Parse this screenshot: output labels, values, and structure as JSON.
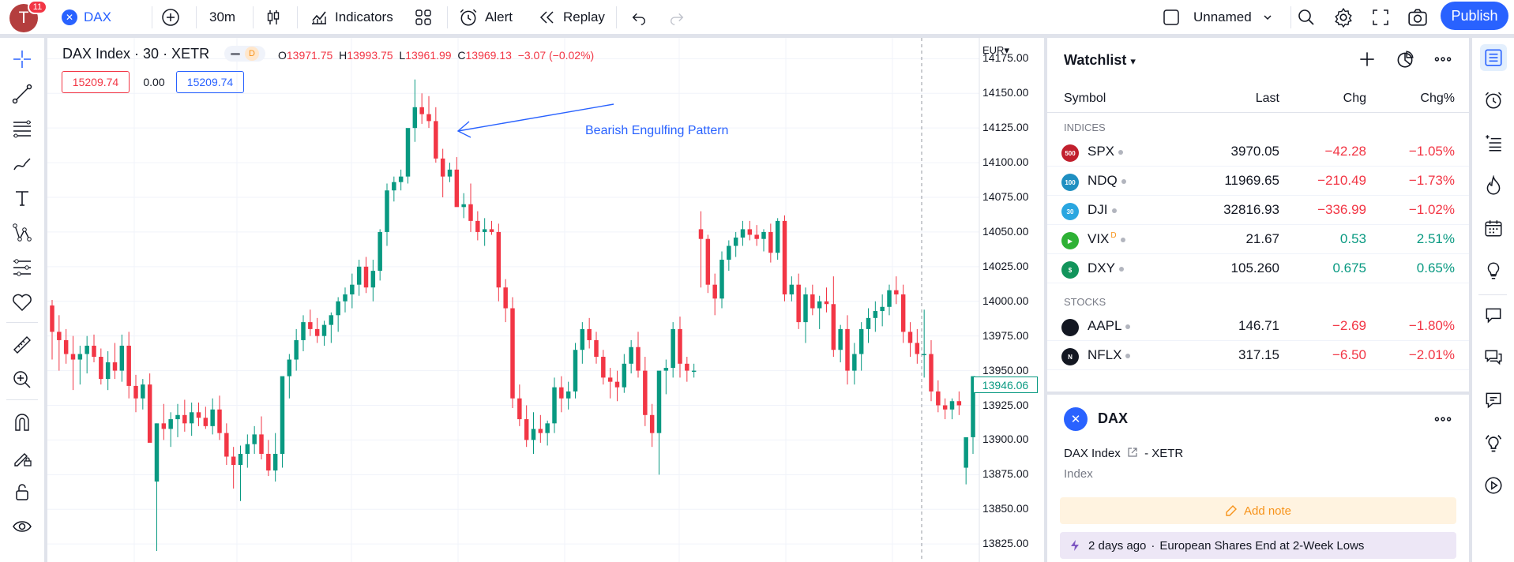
{
  "header": {
    "avatar_letter": "T",
    "notification_count": "11",
    "symbol": "DAX",
    "symbol_logo_glyph": "✕",
    "interval": "30m",
    "indicators_label": "Indicators",
    "alert_label": "Alert",
    "replay_label": "Replay",
    "layout_name": "Unnamed",
    "publish_label": "Publish",
    "icons": [
      "plus-circle-icon",
      "candles-icon",
      "indicators-icon",
      "templates-grid-icon",
      "alarm-clock-icon",
      "replay-icon",
      "undo-icon",
      "redo-icon",
      "layout-square-icon",
      "chevron-down-icon",
      "search-icon",
      "gear-icon",
      "fullscreen-icon",
      "camera-icon"
    ]
  },
  "left_toolbar": {
    "icons": [
      "crosshair-icon",
      "trend-line-icon",
      "fib-icon",
      "brush-icon",
      "text-icon",
      "pattern-icon",
      "forecast-icon",
      "favorites-heart-icon",
      "ruler-icon",
      "zoom-in-icon",
      "magnet-icon",
      "lock-drawing-icon",
      "lock-icon",
      "eye-icon"
    ]
  },
  "legend": {
    "title": "DAX Index · 30 · XETR",
    "delay_badge": "D",
    "open_label": "O",
    "open": "13971.75",
    "high_label": "H",
    "high": "13993.75",
    "low_label": "L",
    "low": "13961.99",
    "close_label": "C",
    "close": "13969.13",
    "change": "−3.07 (−0.02%)",
    "bid": "15209.74",
    "spread": "0.00",
    "ask": "15209.74"
  },
  "chart_data": {
    "type": "candlestick",
    "currency": "EUR",
    "annotation": "Bearish Engulfing Pattern",
    "last_price": "13946.06",
    "y_ticks": [
      "14175.00",
      "14150.00",
      "14125.00",
      "14100.00",
      "14075.00",
      "14050.00",
      "14025.00",
      "14000.00",
      "13975.00",
      "13950.00",
      "13925.00",
      "13900.00",
      "13875.00",
      "13850.00",
      "13825.00"
    ],
    "ylim": [
      13812,
      14190
    ],
    "colors": {
      "up": "#089981",
      "down": "#f23645",
      "grid": "#f0f3fa",
      "annotation": "#2962ff"
    },
    "candles": [
      [
        13997,
        14001,
        13958,
        13978
      ],
      [
        13978,
        13990,
        13950,
        13972
      ],
      [
        13972,
        13980,
        13955,
        13962
      ],
      [
        13962,
        13975,
        13936,
        13958
      ],
      [
        13958,
        13968,
        13940,
        13962
      ],
      [
        13962,
        13975,
        13948,
        13968
      ],
      [
        13968,
        13976,
        13956,
        13960
      ],
      [
        13960,
        13966,
        13940,
        13944
      ],
      [
        13944,
        13964,
        13936,
        13956
      ],
      [
        13956,
        13970,
        13944,
        13950
      ],
      [
        13950,
        13976,
        13942,
        13968
      ],
      [
        13968,
        13978,
        13930,
        13939
      ],
      [
        13939,
        13947,
        13920,
        13930
      ],
      [
        13930,
        13944,
        13922,
        13940
      ],
      [
        13940,
        13948,
        13921,
        13898
      ],
      [
        13870,
        13912,
        13820,
        13912
      ],
      [
        13912,
        13926,
        13900,
        13908
      ],
      [
        13908,
        13920,
        13895,
        13915
      ],
      [
        13915,
        13926,
        13902,
        13918
      ],
      [
        13918,
        13929,
        13906,
        13912
      ],
      [
        13912,
        13927,
        13903,
        13920
      ],
      [
        13920,
        13927,
        13910,
        13916
      ],
      [
        13916,
        13924,
        13908,
        13910
      ],
      [
        13910,
        13930,
        13904,
        13922
      ],
      [
        13922,
        13932,
        13900,
        13905
      ],
      [
        13905,
        13912,
        13882,
        13888
      ],
      [
        13888,
        13895,
        13865,
        13882
      ],
      [
        13882,
        13896,
        13856,
        13890
      ],
      [
        13890,
        13904,
        13880,
        13897
      ],
      [
        13897,
        13910,
        13890,
        13904
      ],
      [
        13904,
        13917,
        13886,
        13890
      ],
      [
        13890,
        13900,
        13874,
        13878
      ],
      [
        13878,
        13905,
        13870,
        13890
      ],
      [
        13890,
        13935,
        13880,
        13946
      ],
      [
        13946,
        13962,
        13930,
        13958
      ],
      [
        13958,
        13980,
        13950,
        13972
      ],
      [
        13972,
        13990,
        13964,
        13985
      ],
      [
        13985,
        13994,
        13975,
        13980
      ],
      [
        13980,
        13988,
        13970,
        13975
      ],
      [
        13975,
        13986,
        13968,
        13983
      ],
      [
        13983,
        13992,
        13970,
        13990
      ],
      [
        13990,
        14003,
        13978,
        14000
      ],
      [
        14000,
        14010,
        13992,
        14005
      ],
      [
        14005,
        14020,
        13995,
        14012
      ],
      [
        14012,
        14030,
        14004,
        14025
      ],
      [
        14025,
        14032,
        14006,
        14010
      ],
      [
        14010,
        14030,
        14000,
        14022
      ],
      [
        14022,
        14052,
        14015,
        14050
      ],
      [
        14050,
        14085,
        14040,
        14080
      ],
      [
        14080,
        14090,
        14072,
        14086
      ],
      [
        14086,
        14095,
        14080,
        14090
      ],
      [
        14090,
        14113,
        14085,
        14125
      ],
      [
        14125,
        14160,
        14115,
        14140
      ],
      [
        14140,
        14150,
        14128,
        14135
      ],
      [
        14135,
        14148,
        14125,
        14130
      ],
      [
        14130,
        14140,
        14100,
        14103
      ],
      [
        14103,
        14110,
        14075,
        14090
      ],
      [
        14090,
        14100,
        14086,
        14095
      ],
      [
        14095,
        14104,
        14080,
        14068
      ],
      [
        14068,
        14078,
        14060,
        14070
      ],
      [
        14070,
        14085,
        14050,
        14058
      ],
      [
        14058,
        14065,
        14044,
        14050
      ],
      [
        14050,
        14060,
        14040,
        14052
      ],
      [
        14052,
        14058,
        14048,
        14050
      ],
      [
        14050,
        14056,
        14000,
        14010
      ],
      [
        14010,
        14016,
        13985,
        13995
      ],
      [
        13995,
        14003,
        13923,
        13930
      ],
      [
        13930,
        13940,
        13910,
        13915
      ],
      [
        13915,
        13925,
        13895,
        13900
      ],
      [
        13900,
        13920,
        13890,
        13908
      ],
      [
        13908,
        13918,
        13898,
        13905
      ],
      [
        13905,
        13914,
        13896,
        13912
      ],
      [
        13912,
        13945,
        13905,
        13938
      ],
      [
        13938,
        13946,
        13920,
        13930
      ],
      [
        13930,
        13942,
        13922,
        13935
      ],
      [
        13935,
        13970,
        13930,
        13965
      ],
      [
        13965,
        13985,
        13955,
        13980
      ],
      [
        13980,
        13988,
        13966,
        13972
      ],
      [
        13972,
        13978,
        13955,
        13960
      ],
      [
        13960,
        13965,
        13940,
        13945
      ],
      [
        13945,
        13952,
        13930,
        13942
      ],
      [
        13942,
        13950,
        13928,
        13938
      ],
      [
        13938,
        13962,
        13934,
        13955
      ],
      [
        13955,
        13972,
        13948,
        13967
      ],
      [
        13967,
        13978,
        13945,
        13950
      ],
      [
        13950,
        13960,
        13910,
        13918
      ],
      [
        13918,
        13926,
        13895,
        13905
      ],
      [
        13905,
        13935,
        13875,
        13950
      ],
      [
        13950,
        13958,
        13933,
        13952
      ],
      [
        13952,
        13985,
        13945,
        13980
      ],
      [
        13980,
        13989,
        13945,
        13955
      ],
      [
        13955,
        13960,
        13942,
        13950
      ],
      [
        13950,
        13955,
        13945,
        13950
      ],
      [
        14052,
        14065,
        14010,
        14045
      ],
      [
        14045,
        14048,
        14006,
        14012
      ],
      [
        14012,
        14020,
        13990,
        14002
      ],
      [
        14002,
        14036,
        13995,
        14030
      ],
      [
        14030,
        14044,
        14022,
        14040
      ],
      [
        14040,
        14050,
        14032,
        14046
      ],
      [
        14046,
        14058,
        14040,
        14052
      ],
      [
        14052,
        14058,
        14044,
        14048
      ],
      [
        14048,
        14055,
        14040,
        14045
      ],
      [
        14045,
        14052,
        14036,
        14050
      ],
      [
        14050,
        14056,
        14028,
        14035
      ],
      [
        14035,
        14060,
        14030,
        14058
      ],
      [
        14058,
        14062,
        14000,
        14005
      ],
      [
        14005,
        14018,
        14000,
        14012
      ],
      [
        14012,
        14020,
        13980,
        13985
      ],
      [
        13985,
        14010,
        13970,
        14005
      ],
      [
        14005,
        14012,
        13990,
        13995
      ],
      [
        13995,
        14004,
        13980,
        14000
      ],
      [
        14000,
        14010,
        13992,
        13998
      ],
      [
        13998,
        14018,
        13960,
        13965
      ],
      [
        13965,
        13983,
        13956,
        13980
      ],
      [
        13980,
        13990,
        13940,
        13950
      ],
      [
        13950,
        13970,
        13940,
        13962
      ],
      [
        13962,
        13985,
        13950,
        13980
      ],
      [
        13980,
        13995,
        13970,
        13988
      ],
      [
        13988,
        14000,
        13978,
        13993
      ],
      [
        13993,
        14005,
        13982,
        13996
      ],
      [
        13996,
        14012,
        13990,
        14008
      ],
      [
        14008,
        14018,
        13998,
        14005
      ],
      [
        14005,
        14012,
        13970,
        13978
      ],
      [
        13978,
        13985,
        13960,
        13970
      ],
      [
        13970,
        13980,
        13955,
        13962
      ],
      [
        13962,
        13994,
        13945,
        13962
      ],
      [
        13962,
        13972,
        13928,
        13935
      ],
      [
        13935,
        13943,
        13920,
        13925
      ],
      [
        13925,
        13930,
        13915,
        13922
      ],
      [
        13922,
        13930,
        13915,
        13928
      ],
      [
        13928,
        13935,
        13918,
        13925
      ],
      [
        13880,
        13898,
        13868,
        13902
      ],
      [
        13902,
        13935,
        13890,
        13946
      ]
    ]
  },
  "watchlist": {
    "title": "Watchlist",
    "columns": {
      "symbol": "Symbol",
      "last": "Last",
      "chg": "Chg",
      "chgp": "Chg%"
    },
    "sections": [
      {
        "name": "INDICES",
        "rows": [
          {
            "logo": "500",
            "logo_color": "#c11f2d",
            "symbol": "SPX",
            "last": "3970.05",
            "chg": "−42.28",
            "chgp": "−1.05%",
            "dir": "down"
          },
          {
            "logo": "100",
            "logo_color": "#1f8fc1",
            "symbol": "NDQ",
            "last": "11969.65",
            "chg": "−210.49",
            "chgp": "−1.73%",
            "dir": "down"
          },
          {
            "logo": "30",
            "logo_color": "#2aa6e0",
            "symbol": "DJI",
            "last": "32816.93",
            "chg": "−336.99",
            "chgp": "−1.02%",
            "dir": "down"
          },
          {
            "logo": "▶",
            "logo_color": "#2eb135",
            "symbol": "VIX",
            "badge": "D",
            "last": "21.67",
            "chg": "0.53",
            "chgp": "2.51%",
            "dir": "up"
          },
          {
            "logo": "$",
            "logo_color": "#12945b",
            "symbol": "DXY",
            "last": "105.260",
            "chg": "0.675",
            "chgp": "0.65%",
            "dir": "up"
          }
        ]
      },
      {
        "name": "STOCKS",
        "rows": [
          {
            "logo": "",
            "logo_color": "#131722",
            "symbol": "AAPL",
            "last": "146.71",
            "chg": "−2.69",
            "chgp": "−1.80%",
            "dir": "down"
          },
          {
            "logo": "N",
            "logo_color": "#131722",
            "symbol": "NFLX",
            "last": "317.15",
            "chg": "−6.50",
            "chgp": "−2.01%",
            "dir": "down"
          }
        ]
      }
    ]
  },
  "details": {
    "symbol": "DAX",
    "logo_glyph": "✕",
    "name": "DAX Index",
    "exchange": "XETR",
    "separator": "-",
    "type": "Index",
    "add_note_label": "Add note",
    "news_time": "2 days ago",
    "news_dot": "·",
    "news_headline": "European Shares End at 2-Week Lows"
  },
  "right_toolbar": {
    "icons": [
      "watchlist-icon",
      "alarm-icon",
      "object-tree-icon",
      "hotlists-icon",
      "calendar-icon",
      "ideas-icon",
      "chats-icon",
      "streams-icon",
      "notifications-icon",
      "help-icon",
      "play-icon"
    ]
  }
}
